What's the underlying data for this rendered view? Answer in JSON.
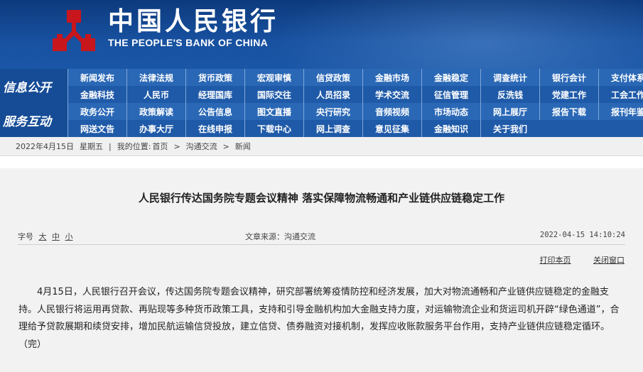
{
  "header": {
    "brand_cn": "中国人民银行",
    "brand_en": "THE PEOPLE'S BANK OF CHINA",
    "logo_icon": "pboc-emblem-icon",
    "colors": {
      "header_bg": "#0d3a7d",
      "logo_red": "#c8161d"
    }
  },
  "nav": {
    "section_a": "信息公开",
    "section_b": "服务互动",
    "rows": [
      [
        "新闻发布",
        "法律法规",
        "货币政策",
        "宏观审慎",
        "信贷政策",
        "金融市场",
        "金融稳定",
        "调查统计",
        "银行会计",
        "支付体系"
      ],
      [
        "金融科技",
        "人民币",
        "经理国库",
        "国际交往",
        "人员招录",
        "学术交流",
        "征信管理",
        "反洗钱",
        "党建工作",
        "工会工作"
      ],
      [
        "政务公开",
        "政策解读",
        "公告信息",
        "图文直播",
        "央行研究",
        "音频视频",
        "市场动态",
        "网上展厅",
        "报告下载",
        "报刊年鉴"
      ],
      [
        "网送文告",
        "办事大厅",
        "在线申报",
        "下载中心",
        "网上调查",
        "意见征集",
        "金融知识",
        "关于我们"
      ]
    ]
  },
  "breadcrumb": {
    "date": "2022年4月15日",
    "weekday": "星期五",
    "sep1": "|",
    "location_label": "我的位置:",
    "home": "首页",
    "arrow1": ">",
    "section": "沟通交流",
    "arrow2": ">",
    "page": "新闻"
  },
  "article": {
    "title": "人民银行传达国务院专题会议精神  落实保障物流畅通和产业链供应链稳定工作",
    "font_size_label": "字号",
    "font_large": "大",
    "font_medium": "中",
    "font_small": "小",
    "source": "文章来源：沟通交流",
    "datetime": "2022-04-15 14:10:24",
    "print_label": "打印本页",
    "close_label": "关闭窗口",
    "body": "4月15日，人民银行召开会议，传达国务院专题会议精神，研究部署统筹疫情防控和经济发展，加大对物流通畅和产业链供应链稳定的金融支持。人民银行将运用再贷款、再贴现等多种货币政策工具，支持和引导金融机构加大金融支持力度，对运输物流企业和货运司机开辟“绿色通道”，合理给予贷款展期和续贷安排，增加民航运输信贷投放，建立信贷、债券融资对接机制，发挥应收账款服务平台作用，支持产业链供应链稳定循环。（完）"
  }
}
